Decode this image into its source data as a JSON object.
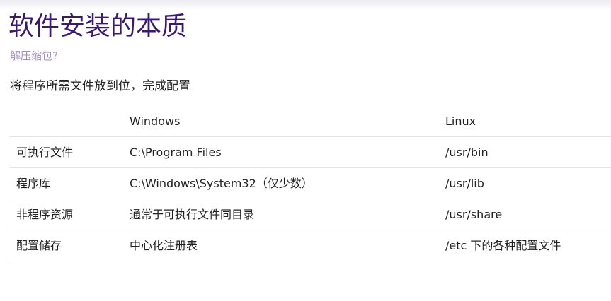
{
  "slide": {
    "title": "软件安装的本质",
    "subtitle": "解压缩包?",
    "lead": "将程序所需文件放到位，完成配置"
  },
  "table": {
    "headers": [
      "",
      "Windows",
      "Linux"
    ],
    "rows": [
      [
        "可执行文件",
        "C:\\Program Files",
        "/usr/bin"
      ],
      [
        "程序库",
        "C:\\Windows\\System32（仅少数）",
        "/usr/lib"
      ],
      [
        "非程序资源",
        "通常于可执行文件同目录",
        "/usr/share"
      ],
      [
        "配置储存",
        "中心化注册表",
        "/etc 下的各种配置文件"
      ]
    ]
  },
  "colors": {
    "title": "#3a1a6e",
    "subtitle": "#a08fc0",
    "text": "#222222",
    "divider": "#e3e3e3"
  }
}
